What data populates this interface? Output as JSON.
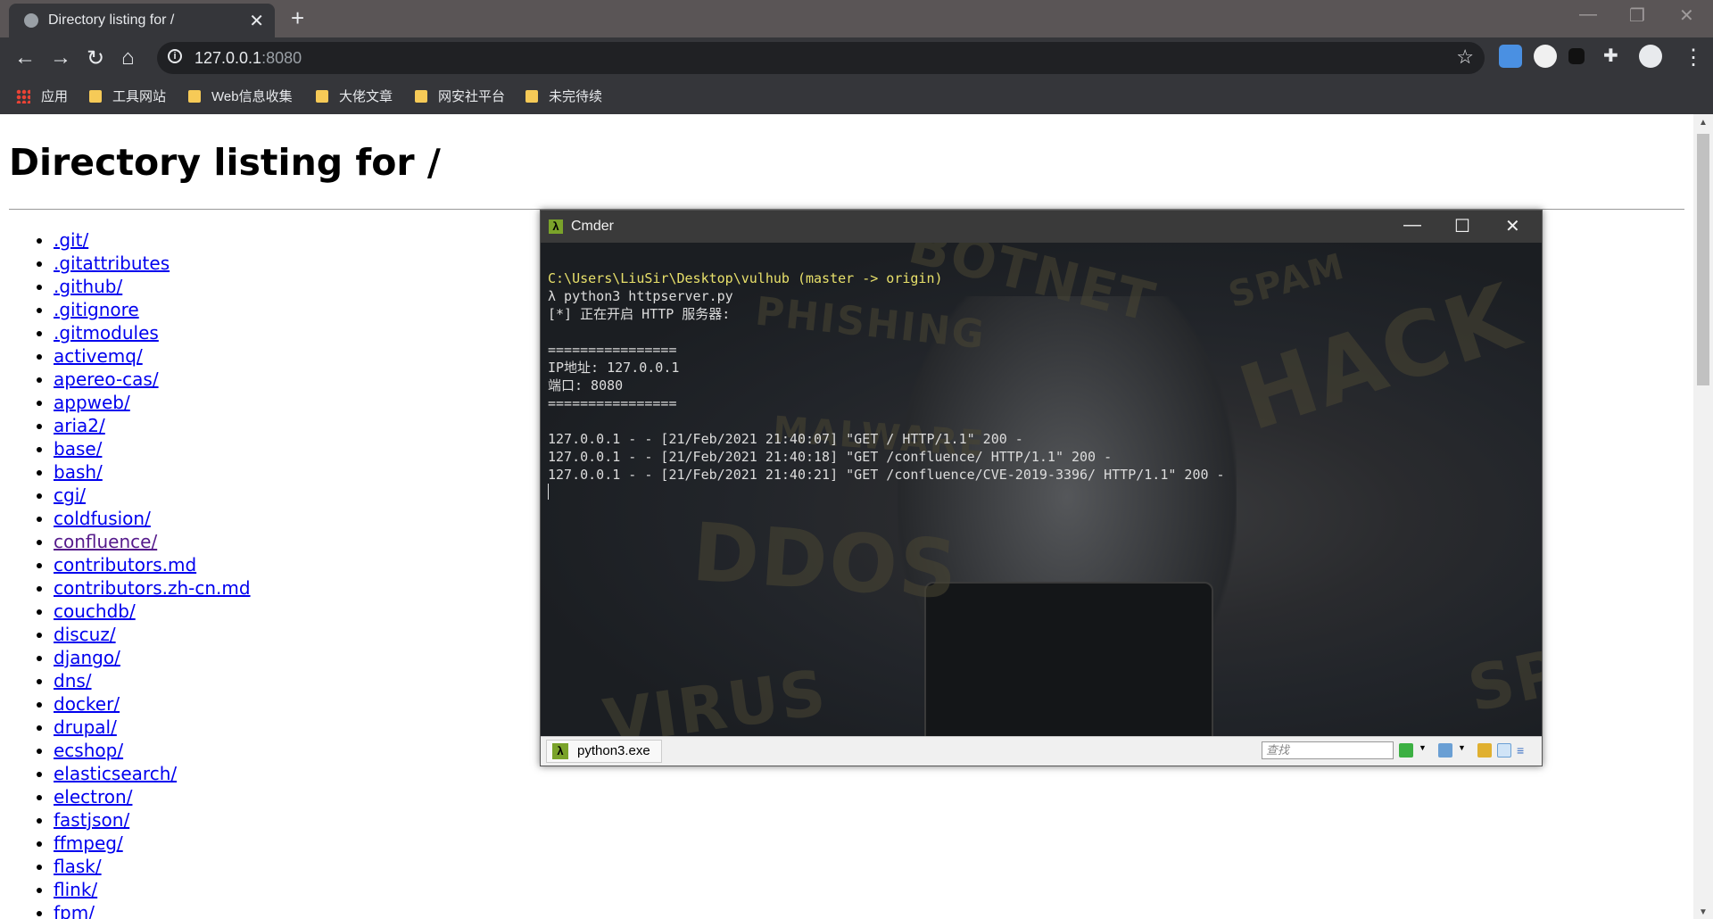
{
  "browser": {
    "tab_title": "Directory listing for /",
    "tab_close": "✕",
    "new_tab": "+",
    "window_controls": {
      "minimize": "—",
      "restore": "❐",
      "close": "✕"
    },
    "nav": {
      "back": "←",
      "forward": "→",
      "reload": "↻",
      "home": "⌂"
    },
    "url_host": "127.0.0.1",
    "url_port": ":8080",
    "bookmark_star": "☆",
    "menu": "⋮",
    "bookmarks": [
      {
        "label": "应用",
        "icon": "apps-grid-icon"
      },
      {
        "label": "工具网站",
        "icon": "folder-icon"
      },
      {
        "label": "Web信息收集",
        "icon": "folder-icon"
      },
      {
        "label": "大佬文章",
        "icon": "folder-icon"
      },
      {
        "label": "网安社平台",
        "icon": "folder-icon"
      },
      {
        "label": "未完待续",
        "icon": "folder-icon"
      }
    ]
  },
  "page": {
    "heading": "Directory listing for /",
    "entries": [
      ".git/",
      ".gitattributes",
      ".github/",
      ".gitignore",
      ".gitmodules",
      "activemq/",
      "apereo-cas/",
      "appweb/",
      "aria2/",
      "base/",
      "bash/",
      "cgi/",
      "coldfusion/",
      "confluence/",
      "contributors.md",
      "contributors.zh-cn.md",
      "couchdb/",
      "discuz/",
      "django/",
      "dns/",
      "docker/",
      "drupal/",
      "ecshop/",
      "elasticsearch/",
      "electron/",
      "fastjson/",
      "ffmpeg/",
      "flask/",
      "flink/",
      "fpm/"
    ],
    "visited_entry": "confluence/"
  },
  "cmder": {
    "title": "Cmder",
    "logo": "λ",
    "controls": {
      "minimize": "—",
      "maximize": "☐",
      "close": "✕"
    },
    "prompt_path": "C:\\Users\\LiuSir\\Desktop\\vulhub (master -> origin)",
    "lines": [
      "λ python3 httpserver.py",
      "[*] 正在开启 HTTP 服务器:",
      "",
      "================",
      "IP地址: 127.0.0.1",
      "端口: 8080",
      "================",
      "",
      "127.0.0.1 - - [21/Feb/2021 21:40:07] \"GET / HTTP/1.1\" 200 -",
      "127.0.0.1 - - [21/Feb/2021 21:40:18] \"GET /confluence/ HTTP/1.1\" 200 -",
      "127.0.0.1 - - [21/Feb/2021 21:40:21] \"GET /confluence/CVE-2019-3396/ HTTP/1.1\" 200 -"
    ],
    "status_tab": "python3.exe",
    "search_placeholder": "查找",
    "background_words": [
      "BOTNET",
      "PHISHING",
      "HACK",
      "DDOS",
      "VIRUS",
      "MALWARE",
      "SPAM",
      "SP"
    ]
  },
  "colors": {
    "link": "#0000ee",
    "visited": "#551a8b",
    "chrome_dark": "#35363a",
    "prompt_yellow": "#e8e06a"
  }
}
